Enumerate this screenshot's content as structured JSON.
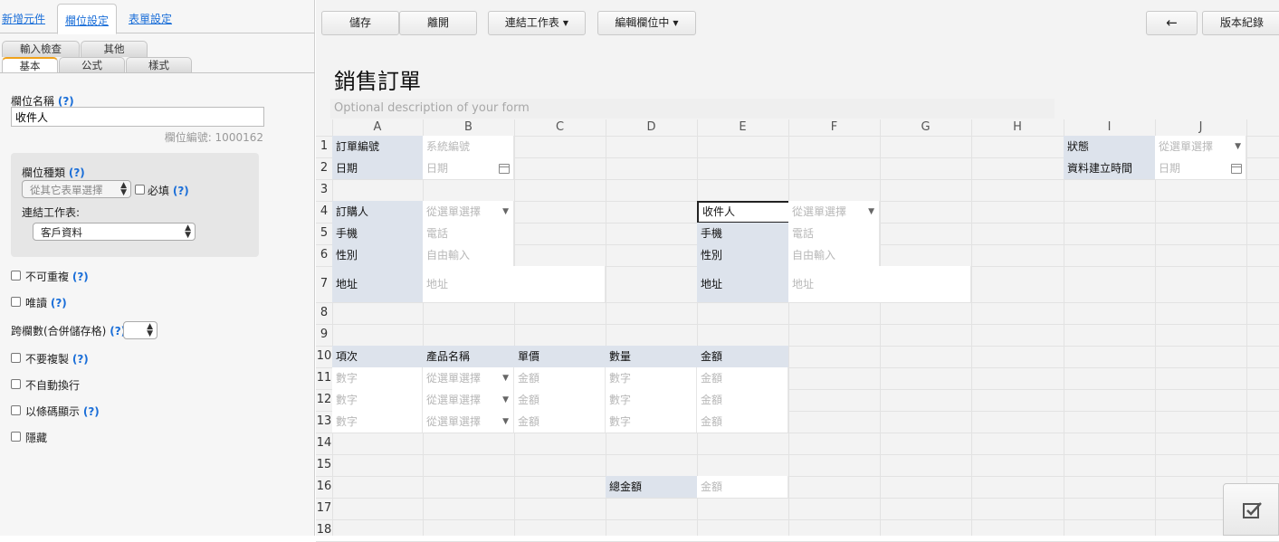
{
  "left_panel": {
    "top_tabs": [
      "新增元件",
      "欄位設定",
      "表單設定"
    ],
    "sub_tabs_row1": [
      "輸入檢查",
      "其他"
    ],
    "sub_tabs_row2": [
      "基本",
      "公式",
      "樣式"
    ],
    "field_name_label": "欄位名稱",
    "help": "(?)",
    "field_name_value": "收件人",
    "field_no": "欄位編號: 1000162",
    "field_type_label": "欄位種類",
    "field_type_value": "從其它表單選擇",
    "required_label": "必填",
    "link_sheet_label": "連結工作表:",
    "link_sheet_value": "客戶資料",
    "options": {
      "unique": "不可重複",
      "readonly": "唯讀",
      "colspan": "跨欄數(合併儲存格)",
      "no_copy": "不要複製",
      "no_wrap": "不自動換行",
      "barcode": "以條碼顯示",
      "hidden": "隱藏"
    }
  },
  "toolbar": {
    "save": "儲存",
    "leave": "離開",
    "link_sheet": "連結工作表",
    "edit_field": "編輯欄位中",
    "back_arrow": "←",
    "history": "版本紀錄"
  },
  "form": {
    "title": "銷售訂單",
    "description": "Optional description of your form",
    "columns": [
      "A",
      "B",
      "C",
      "D",
      "E",
      "F",
      "G",
      "H",
      "I",
      "J"
    ],
    "rows": [
      "1",
      "2",
      "3",
      "4",
      "5",
      "6",
      "7",
      "8",
      "9",
      "10",
      "11",
      "12",
      "13",
      "14",
      "15",
      "16",
      "17",
      "18"
    ],
    "cells": {
      "order_no_label": "訂單編號",
      "order_no_ph": "系統編號",
      "date_label": "日期",
      "date_ph": "日期",
      "status_label": "狀態",
      "status_ph": "從選單選擇",
      "created_label": "資料建立時間",
      "created_ph": "日期",
      "buyer_label": "訂購人",
      "buyer_ph": "從選單選擇",
      "receiver_value": "收件人",
      "receiver_ph": "從選單選擇",
      "mobile_label": "手機",
      "mobile_ph": "電話",
      "mobile2_label": "手機",
      "mobile2_ph": "電話",
      "gender_label": "性別",
      "gender_ph": "自由輸入",
      "gender2_label": "性別",
      "gender2_ph": "自由輸入",
      "address_label": "地址",
      "address_ph": "地址",
      "address2_label": "地址",
      "address2_ph": "地址",
      "item_label": "項次",
      "product_label": "產品名稱",
      "price_label": "單價",
      "qty_label": "數量",
      "amount_label": "金額",
      "num_ph": "數字",
      "select_ph": "從選單選擇",
      "money_ph": "金額",
      "total_label": "總金額",
      "total_ph": "金額"
    }
  }
}
